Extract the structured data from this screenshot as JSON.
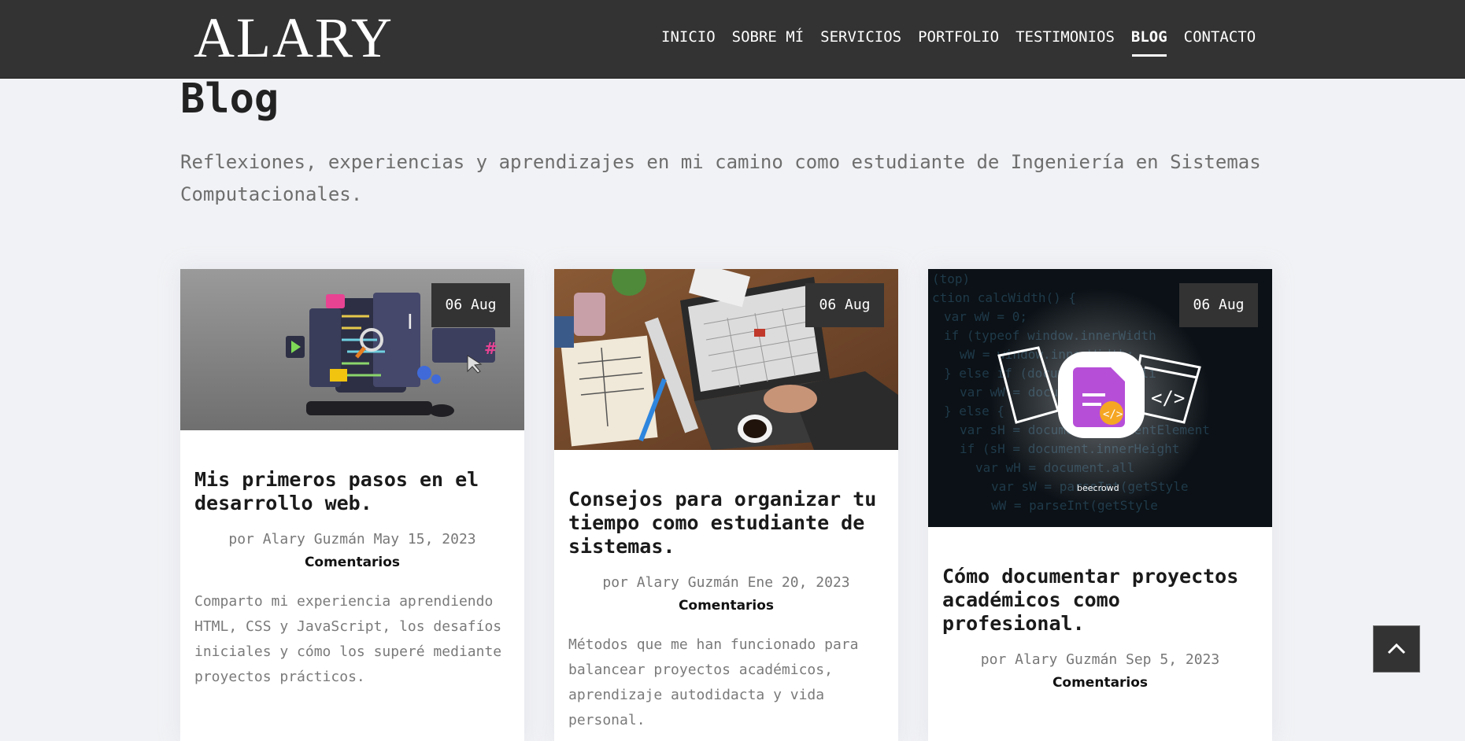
{
  "header": {
    "logo": "ALARY",
    "nav": [
      "INICIO",
      "SOBRE MÍ",
      "SERVICIOS",
      "PORTFOLIO",
      "TESTIMONIOS",
      "BLOG",
      "CONTACTO"
    ],
    "active_nav": "BLOG"
  },
  "page": {
    "title": "Blog",
    "intro": "Reflexiones, experiencias y aprendizajes en mi camino como estudiante de Ingeniería en Sistemas Computacionales."
  },
  "posts": [
    {
      "date": "06 Aug",
      "title": "Mis primeros pasos en el desarrollo web.",
      "meta": "por Alary Guzmán May 15, 2023",
      "comments": "Comentarios",
      "excerpt": "Comparto mi experiencia aprendiendo HTML, CSS y JavaScript, los desafíos iniciales y cómo los superé mediante proyectos prácticos.",
      "image": "web-development-illustration"
    },
    {
      "date": "06 Aug",
      "title": "Consejos para organizar tu tiempo como estudiante de sistemas.",
      "meta": "por Alary Guzmán Ene 20, 2023",
      "comments": "Comentarios",
      "excerpt": "Métodos que me han funcionado para balancear proyectos académicos, aprendizaje autodidacta y vida personal.",
      "image": "laptop-calendar-desk-photo"
    },
    {
      "date": "06 Aug",
      "title": "Cómo documentar proyectos académicos como profesional.",
      "meta": "por Alary Guzmán Sep 5, 2023",
      "comments": "Comentarios",
      "excerpt": "",
      "image": "beecrowd-documentation-graphic",
      "image_caption": "beecrowd"
    }
  ],
  "icons": {
    "scroll_top": "chevron-up-icon"
  }
}
